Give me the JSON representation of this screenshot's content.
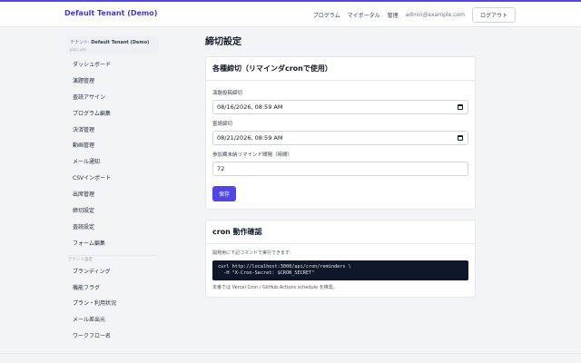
{
  "header": {
    "brand": "Default Tenant (Demo)",
    "nav_links": [
      "プログラム",
      "マイポータル",
      "管理"
    ],
    "user_email": "admin@example.com",
    "logout_label": "ログアウト",
    "accent_color": "#4f46e5"
  },
  "sidebar": {
    "tenant_label": "テナント:",
    "tenant_name": "Default Tenant (Demo)",
    "tenant_plan": "plan: pro",
    "items": [
      "ダッシュボード",
      "演題管理",
      "査読アサイン",
      "プログラム編集",
      "決済管理",
      "動画管理",
      "メール通知",
      "CSVインポート",
      "出席管理",
      "締切設定",
      "査読設定",
      "フォーム編集"
    ],
    "section_label": "テナント設定",
    "settings_items": [
      "ブランディング",
      "機能フラグ",
      "プラン・利用状況",
      "メール差出元",
      "ワークフロー名"
    ]
  },
  "main": {
    "page_title": "締切設定",
    "deadlines_card": {
      "title": "各種締切（リマインダcronで使用）",
      "fields": [
        {
          "label": "演題投稿締切",
          "value": "08/16/2026, 08:59 AM"
        },
        {
          "label": "査読締切",
          "value": "08/21/2026, 08:59 AM"
        },
        {
          "label": "参加費未納リマインド間隔（時間）",
          "value": "72"
        }
      ],
      "save_label": "保存"
    },
    "cron_card": {
      "title": "cron 動作確認",
      "hint": "開発用に下記コマンドで実行できます:",
      "code_line1": "curl http://localhost:3000/api/cron/reminders \\",
      "code_line2": "  -H \"X-Cron-Secret: $CRON_SECRET\"",
      "note": "本番では Vercel Cron / GitHub Actions schedule を推奨。"
    }
  }
}
